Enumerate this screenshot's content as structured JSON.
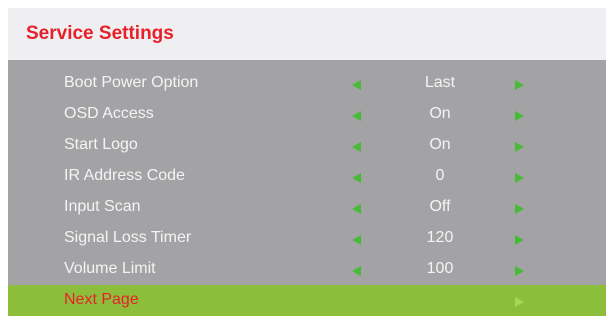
{
  "menu_title": "Service Settings",
  "colors": {
    "title": "#e8202a",
    "arrow": "#49b93a",
    "highlight": "#8cbe3c",
    "menu_bg": "#a3a3a6"
  },
  "items": [
    {
      "label": "Boot Power Option",
      "value": "Last"
    },
    {
      "label": "OSD Access",
      "value": "On"
    },
    {
      "label": "Start Logo",
      "value": "On"
    },
    {
      "label": "IR Address Code",
      "value": "0"
    },
    {
      "label": "Input Scan",
      "value": "Off"
    },
    {
      "label": "Signal Loss Timer",
      "value": "120"
    },
    {
      "label": "Volume Limit",
      "value": "100"
    }
  ],
  "next_page": {
    "label": "Next Page",
    "selected": true
  },
  "icons": {
    "decrease": "left-arrow-icon",
    "increase": "right-arrow-icon"
  }
}
